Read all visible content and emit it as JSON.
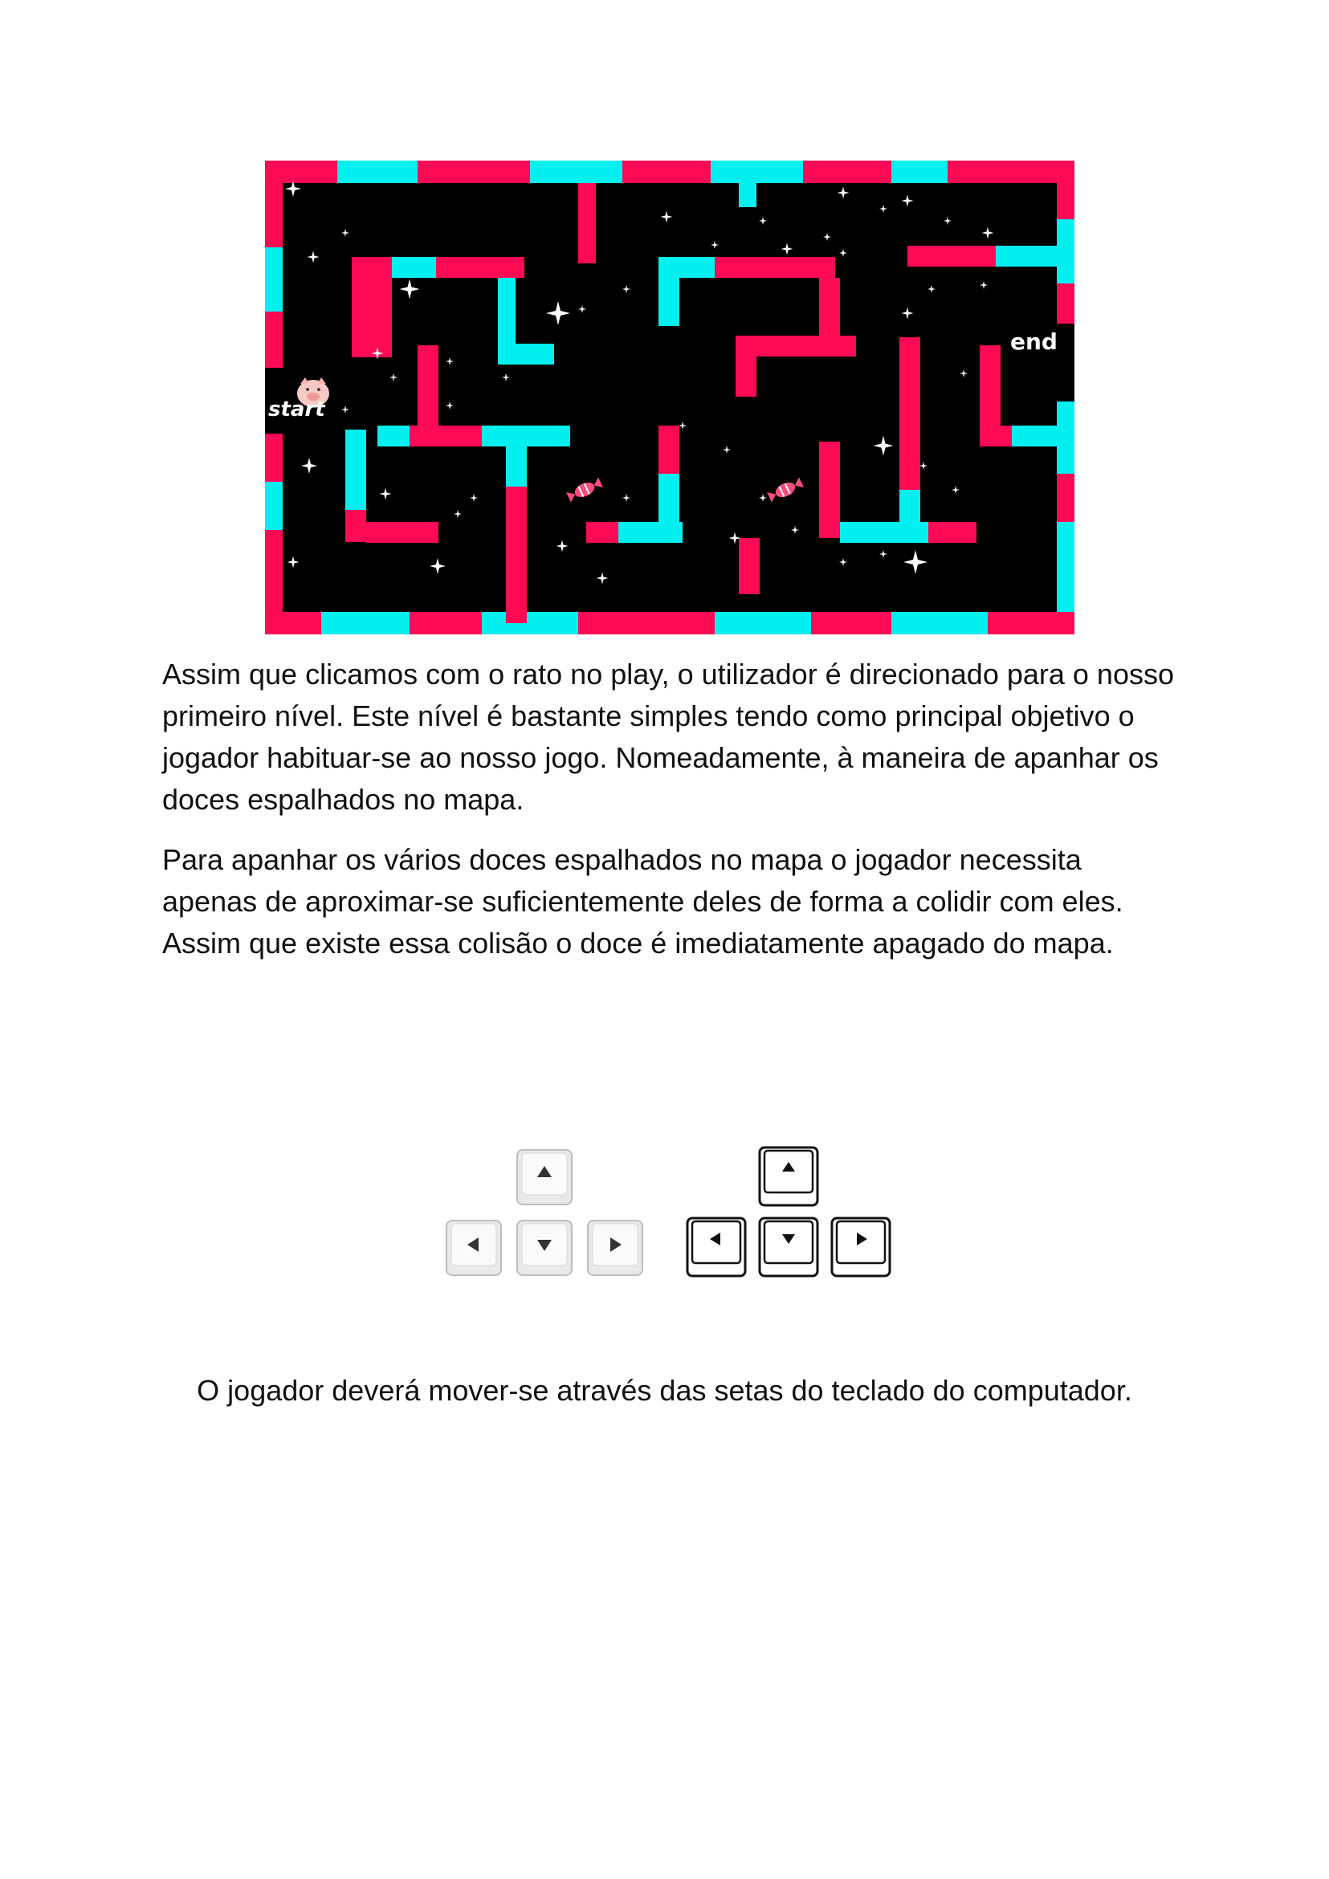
{
  "maze": {
    "start_label": "start",
    "end_label": "end",
    "colors": {
      "background": "#000000",
      "wall_pink": "#ff0a55",
      "wall_cyan": "#00f0f0",
      "star": "#ffffff",
      "candy": "#ff4d7d"
    }
  },
  "paragraphs": [
    "Assim que clicamos com o rato no play, o utilizador é direcionado para o nosso primeiro nível. Este nível é bastante simples tendo como principal objetivo o jogador habituar-se ao nosso jogo. Nomeadamente, à maneira de apanhar os doces espalhados no mapa.",
    "Para apanhar os vários doces espalhados no mapa o jogador necessita apenas de aproximar-se suficientemente deles de forma a colidir com eles. Assim que existe essa colisão o doce é imediatamente apagado do mapa."
  ],
  "caption": "O jogador deverá mover-se através das setas do teclado do computador.",
  "keys": {
    "left_set": [
      "up",
      "left",
      "down",
      "right"
    ],
    "right_set": [
      "up",
      "left",
      "down",
      "right"
    ]
  }
}
